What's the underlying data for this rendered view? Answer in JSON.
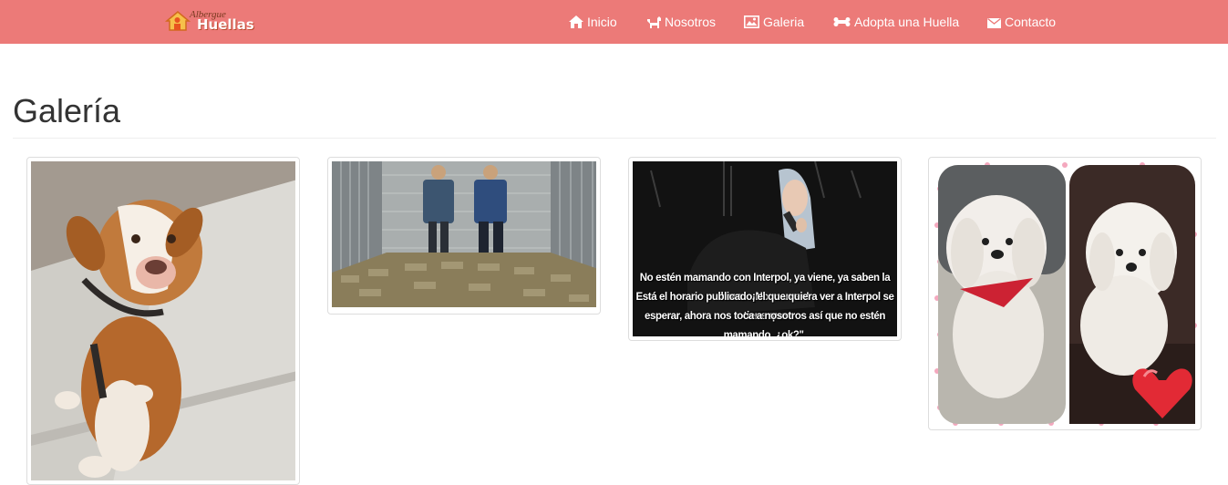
{
  "brand": {
    "line1": "Albergue",
    "line2": "Huellas"
  },
  "nav": {
    "inicio": "Inicio",
    "nosotros": "Nosotros",
    "galeria": "Galeria",
    "adopta": "Adopta una Huella",
    "contacto": "Contacto"
  },
  "page": {
    "title": "Galería"
  },
  "gallery": {
    "caption_lines": [
      "No estén mamando con Interpol, ya viene, ya saben la hora... ¡No mamen!",
      "Está el horario publicado, el que quiera ver a Interpol se tiene que",
      "esperar, ahora nos toca a nosotros así que no estén mamando, ¿ok?\"."
    ]
  },
  "colors": {
    "navbar": "#ec7a78",
    "text": "#333333",
    "border": "#dddddd"
  },
  "icons": [
    "home-icon",
    "dog-icon",
    "image-icon",
    "bone-icon",
    "envelope-icon"
  ]
}
